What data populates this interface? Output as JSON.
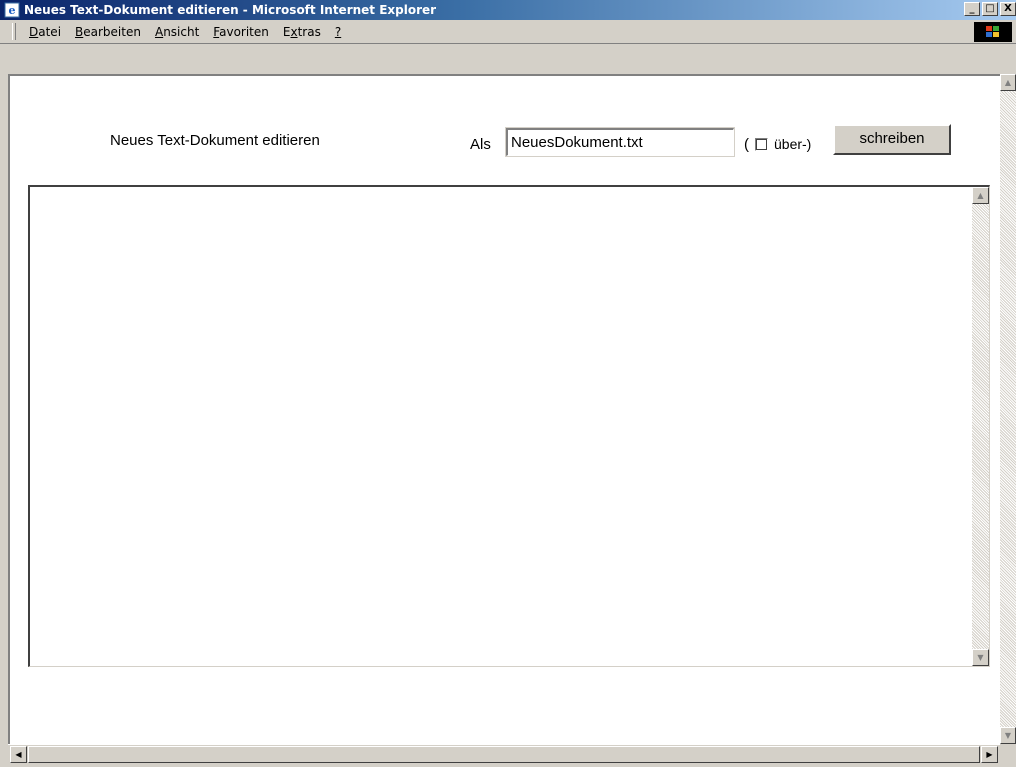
{
  "window": {
    "title": "Neues Text-Dokument editieren - Microsoft Internet Explorer",
    "minimize_label": "_",
    "maximize_label": "□",
    "close_label": "X"
  },
  "menu": {
    "items": [
      {
        "label": "Datei",
        "accel_index": 0
      },
      {
        "label": "Bearbeiten",
        "accel_index": 0
      },
      {
        "label": "Ansicht",
        "accel_index": 0
      },
      {
        "label": "Favoriten",
        "accel_index": 0
      },
      {
        "label": "Extras",
        "accel_index": 1
      },
      {
        "label": "?",
        "accel_index": 0
      }
    ]
  },
  "form": {
    "heading": "Neues Text-Dokument editieren",
    "als_label": "Als",
    "filename_value": "NeuesDokument.txt",
    "paren_open": "(",
    "overwrite_checked": false,
    "overwrite_label": "über-)",
    "submit_label": "schreiben",
    "editor_text": ""
  },
  "icons": {
    "app": "ie-page-icon",
    "throbber": "windows-flag-icon",
    "scroll_up": "up-arrow-icon",
    "scroll_down": "down-arrow-icon",
    "scroll_left": "left-arrow-icon",
    "scroll_right": "right-arrow-icon"
  },
  "colors": {
    "titlebar_start": "#0a246a",
    "titlebar_end": "#a6caf0",
    "chrome": "#d4d0c8"
  }
}
